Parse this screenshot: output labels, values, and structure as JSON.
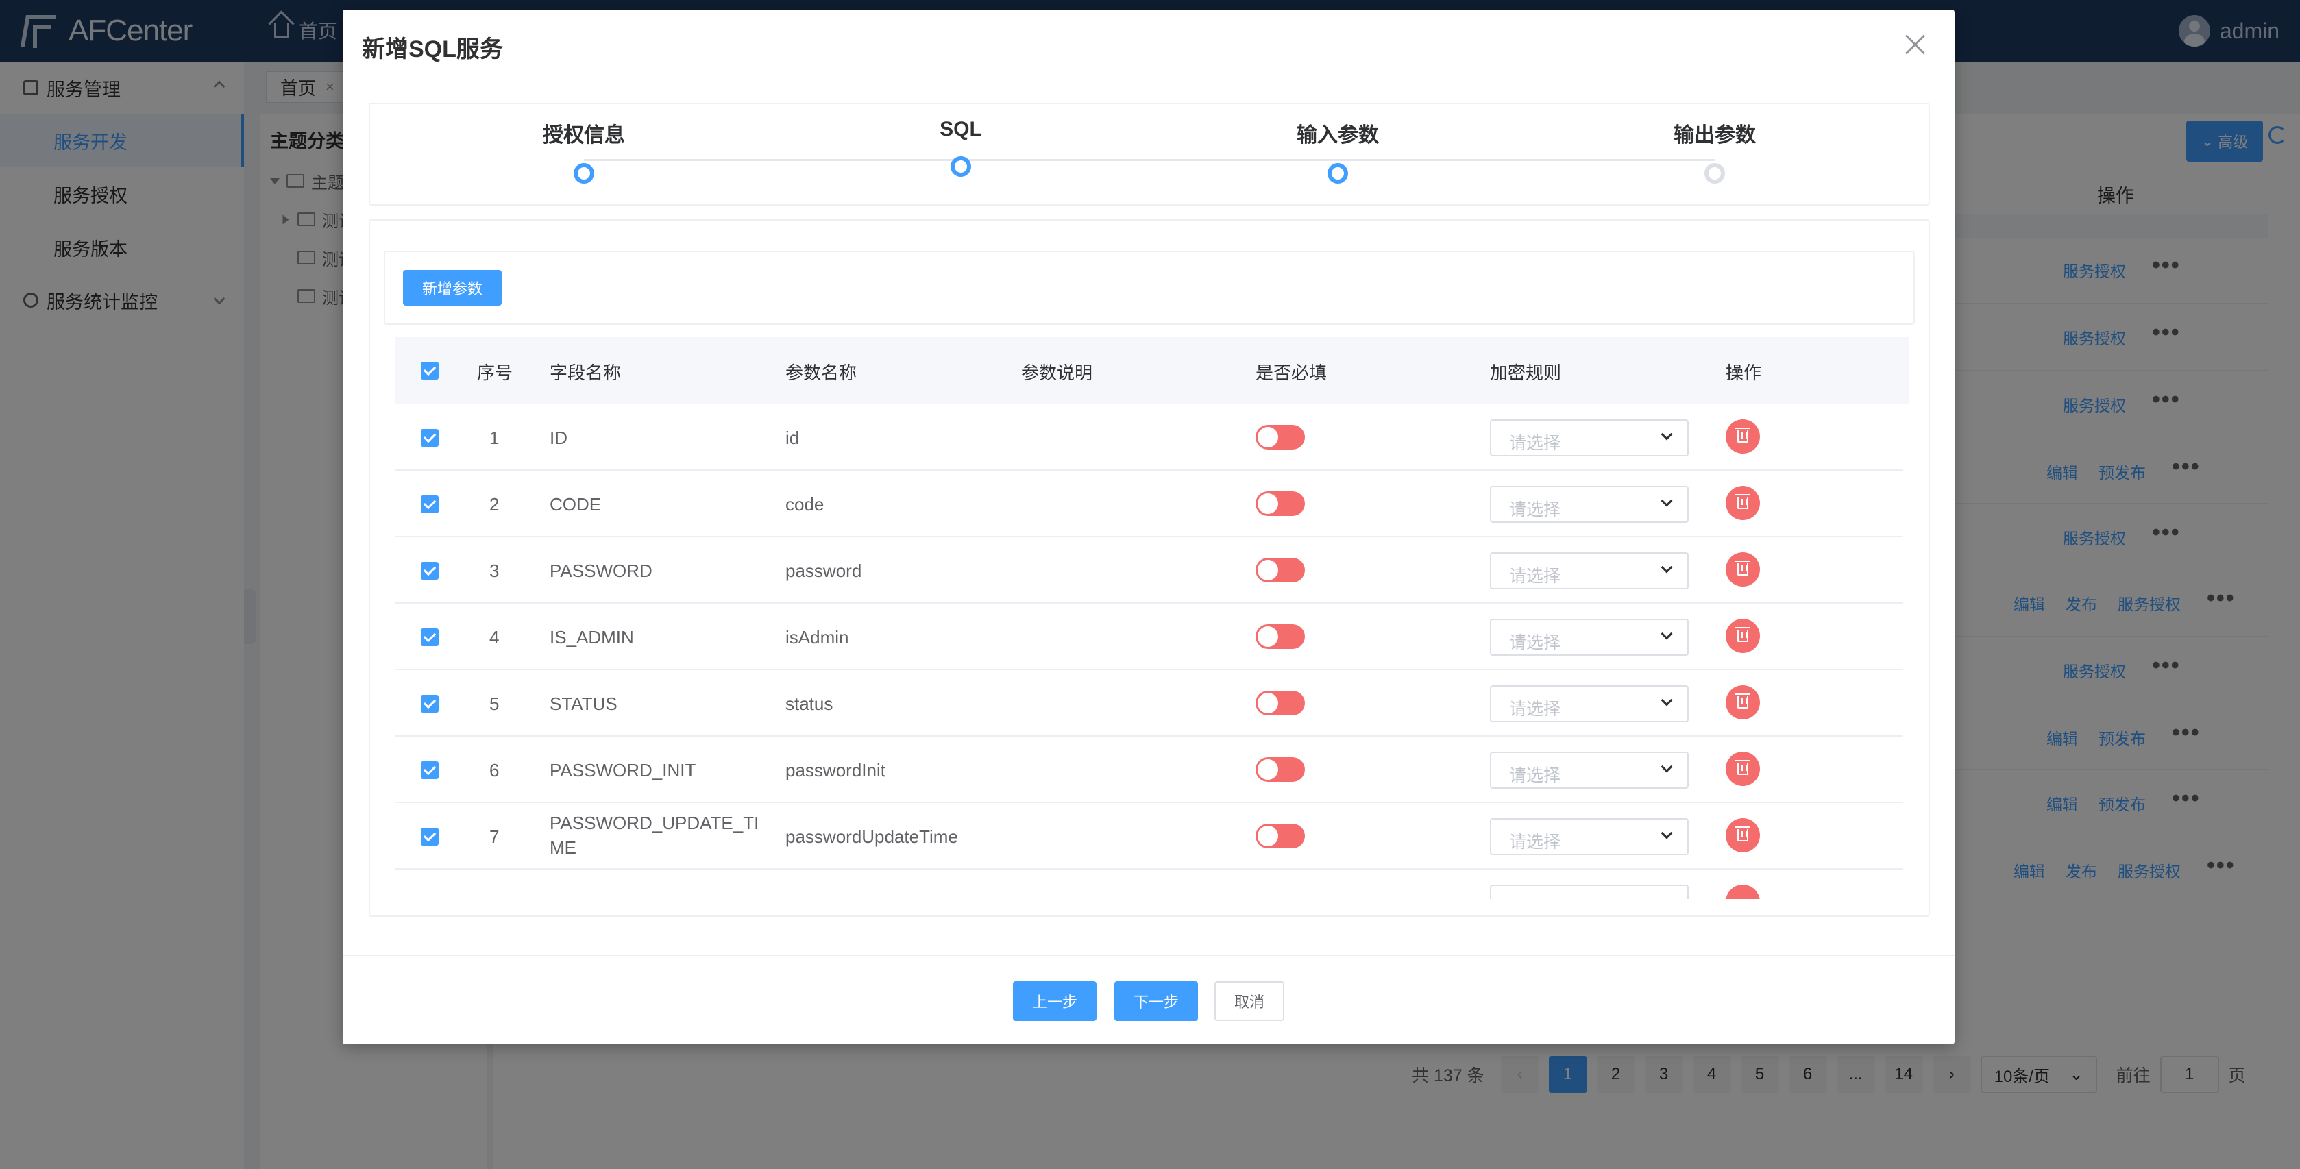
{
  "app": {
    "logo_text": "AFCenter",
    "top_home": "首页",
    "user": "admin"
  },
  "sidebar": {
    "group1": "服务管理",
    "items": [
      "服务开发",
      "服务授权",
      "服务版本"
    ],
    "group2": "服务统计监控"
  },
  "tabs": {
    "home": "首页",
    "close": "×"
  },
  "tree": {
    "title": "主题分类",
    "root": "主题分",
    "children": [
      "测试",
      "测试",
      "测试"
    ]
  },
  "main": {
    "advanced": "高级",
    "op_header": "操作",
    "row_actions": [
      [
        "服务授权"
      ],
      [
        "服务授权"
      ],
      [
        "服务授权"
      ],
      [
        "编辑",
        "预发布"
      ],
      [
        "服务授权"
      ],
      [
        "编辑",
        "发布",
        "服务授权"
      ],
      [
        "服务授权"
      ],
      [
        "编辑",
        "预发布"
      ],
      [
        "编辑",
        "预发布"
      ],
      [
        "编辑",
        "发布",
        "服务授权"
      ]
    ],
    "more": "•••"
  },
  "pager": {
    "total": "共 137 条",
    "pages": [
      "1",
      "2",
      "3",
      "4",
      "5",
      "6",
      "...",
      "14"
    ],
    "page_size": "10条/页",
    "goto": "前往",
    "goto_value": "1",
    "page_unit": "页"
  },
  "dialog": {
    "title": "新增SQL服务",
    "steps": [
      "授权信息",
      "SQL",
      "输入参数",
      "输出参数"
    ],
    "add_param": "新增参数",
    "columns": [
      "序号",
      "字段名称",
      "参数名称",
      "参数说明",
      "是否必填",
      "加密规则",
      "操作"
    ],
    "select_placeholder": "请选择",
    "rows": [
      {
        "index": "1",
        "field": "ID",
        "param": "id",
        "desc": ""
      },
      {
        "index": "2",
        "field": "CODE",
        "param": "code",
        "desc": ""
      },
      {
        "index": "3",
        "field": "PASSWORD",
        "param": "password",
        "desc": ""
      },
      {
        "index": "4",
        "field": "IS_ADMIN",
        "param": "isAdmin",
        "desc": ""
      },
      {
        "index": "5",
        "field": "STATUS",
        "param": "status",
        "desc": ""
      },
      {
        "index": "6",
        "field": "PASSWORD_INIT",
        "param": "passwordInit",
        "desc": ""
      },
      {
        "index": "7",
        "field": "PASSWORD_UPDATE_TI",
        "field_line2": "ME",
        "param": "passwordUpdateTime",
        "desc": ""
      }
    ],
    "prev": "上一步",
    "next": "下一步",
    "cancel": "取消"
  },
  "colors": {
    "primary": "#409eff",
    "danger": "#f56c6c",
    "header": "#1f3a63"
  }
}
